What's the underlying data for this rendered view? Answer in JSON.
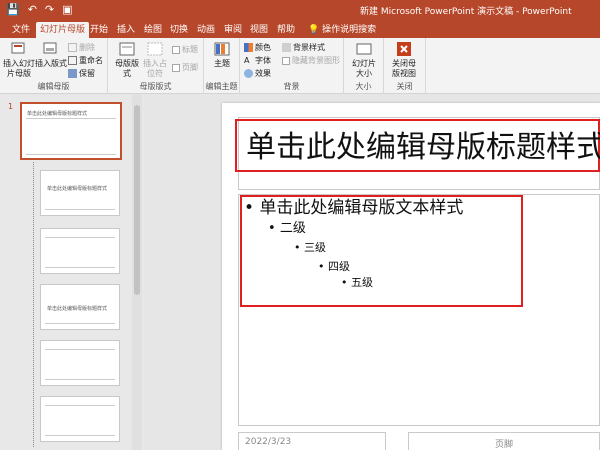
{
  "app": {
    "quick_access": {
      "save": "💾",
      "undo": "↶",
      "redo": "↷",
      "present": "▣"
    },
    "window_title": "新建 Microsoft PowerPoint 演示文稿 - PowerPoint"
  },
  "tabs": [
    "文件",
    "幻灯片母版",
    "开始",
    "插入",
    "绘图",
    "切换",
    "动画",
    "审阅",
    "视图",
    "帮助",
    "操作说明搜索"
  ],
  "ribbon": {
    "edit_master": {
      "insert_master": "插入幻灯片母版",
      "insert_layout": "插入版式",
      "delete": "删除",
      "rename": "重命名",
      "preserve": "保留",
      "label": "编辑母版"
    },
    "master_layout": {
      "master_layout_btn": "母版版式",
      "insert_placeholder": "插入占位符",
      "title_chk": "标题",
      "footer_chk": "页脚",
      "label": "母版版式"
    },
    "edit_theme": {
      "themes": "主题",
      "label": "编辑主题"
    },
    "background": {
      "colors": "颜色",
      "fonts": "字体",
      "effects": "效果",
      "bg_styles": "背景样式",
      "hide_bg": "隐藏背景图形",
      "label": "背景"
    },
    "size": {
      "slide_size": "幻灯片大小",
      "label": "大小"
    },
    "close": {
      "close_master": "关闭母版视图",
      "label": "关闭"
    }
  },
  "thumbnails": {
    "slide_number": "1",
    "master_title": "单击此处编辑母版标题样式",
    "layout2_title": "单击此处编辑母版标题样式",
    "layout4_title": "单击此处编辑母版标题样式"
  },
  "slide": {
    "title": "单击此处编辑母版标题样式",
    "bullets": [
      "单击此处编辑母版文本样式",
      "二级",
      "三级",
      "四级",
      "五级"
    ],
    "date": "2022/3/23",
    "footer": "页脚"
  },
  "colors": {
    "accent": "#b7472a",
    "highlight_border": "#e02020"
  }
}
